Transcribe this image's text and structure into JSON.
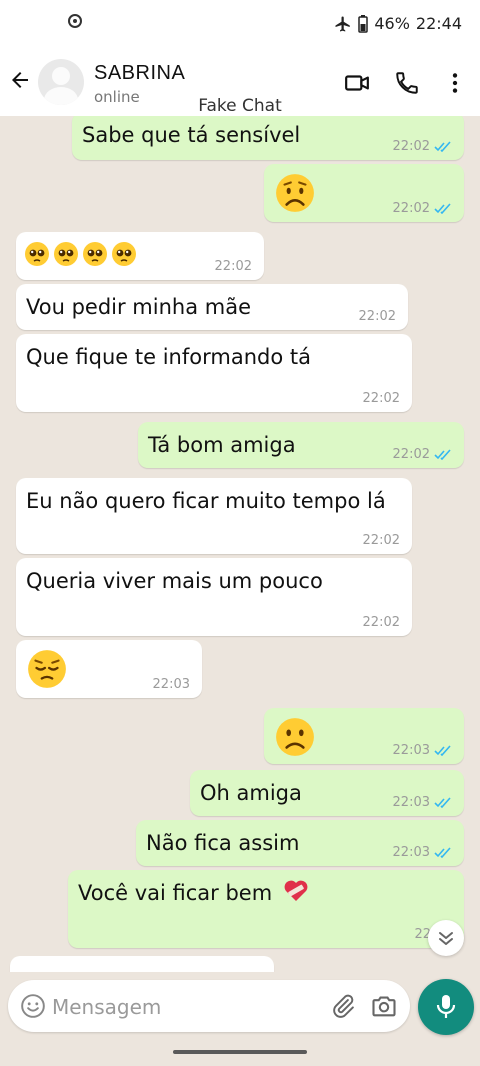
{
  "status_bar": {
    "battery": "46%",
    "time": "22:44"
  },
  "header": {
    "contact_name": "SABRINA",
    "contact_status": "online"
  },
  "watermark": "Fake Chat",
  "messages": [
    {
      "dir": "out",
      "text": "Sabe que tá sensível",
      "time": "22:02",
      "read": true
    },
    {
      "dir": "out",
      "emoji": "worried",
      "time": "22:02",
      "read": true
    },
    {
      "dir": "in",
      "emoji": "pleading x4",
      "time": "22:02"
    },
    {
      "dir": "in",
      "text": "Vou pedir minha mãe",
      "time": "22:02"
    },
    {
      "dir": "in",
      "text": "Que fique te informando tá",
      "time": "22:02"
    },
    {
      "dir": "out",
      "text": "Tá bom amiga",
      "time": "22:02",
      "read": true
    },
    {
      "dir": "in",
      "text": "Eu não quero ficar muito tempo lá",
      "time": "22:02"
    },
    {
      "dir": "in",
      "text": "Queria viver mais um pouco",
      "time": "22:02"
    },
    {
      "dir": "in",
      "emoji": "pensive",
      "time": "22:03"
    },
    {
      "dir": "out",
      "emoji": "slightly-frowning",
      "time": "22:03",
      "read": true
    },
    {
      "dir": "out",
      "text": "Oh amiga",
      "time": "22:03",
      "read": true
    },
    {
      "dir": "out",
      "text": "Não fica assim",
      "time": "22:03",
      "read": true
    },
    {
      "dir": "out",
      "text": "Você vai ficar bem",
      "emoji_after": "mending-heart",
      "time": "22:03"
    }
  ],
  "composer": {
    "placeholder": "Mensagem"
  },
  "colors": {
    "outgoing": "#dcf8c6",
    "incoming": "#ffffff",
    "accent": "#128c7e",
    "read_ticks": "#34b7f1"
  }
}
